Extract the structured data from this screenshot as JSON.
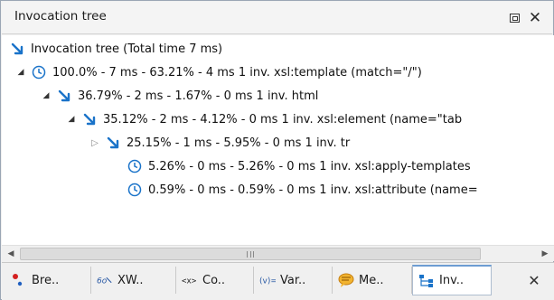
{
  "panel": {
    "title": "Invocation tree",
    "minimize_icon": "restore-icon",
    "close_icon": "close-icon"
  },
  "tree": {
    "rows": [
      {
        "text": "Invocation tree (Total time  7 ms)",
        "icon": "arrow-icon",
        "toggle": "none"
      },
      {
        "text": "100.0% - 7 ms - 63.21% - 4 ms 1 inv. xsl:template (match=\"/\")",
        "icon": "clock-icon",
        "toggle": "expanded"
      },
      {
        "text": "36.79% - 2 ms - 1.67% - 0 ms 1 inv. html",
        "icon": "arrow-icon",
        "toggle": "expanded"
      },
      {
        "text": "35.12% - 2 ms - 4.12% - 0 ms 1 inv. xsl:element (name=\"tab",
        "icon": "arrow-icon",
        "toggle": "expanded"
      },
      {
        "text": "25.15% - 1 ms - 5.95% - 0 ms 1 inv. tr",
        "icon": "arrow-icon",
        "toggle": "collapsed"
      },
      {
        "text": "5.26% - 0 ms - 5.26% - 0 ms 1 inv. xsl:apply-templates",
        "icon": "clock-icon",
        "toggle": "none"
      },
      {
        "text": "0.59% - 0 ms - 0.59% - 0 ms 1 inv. xsl:attribute (name=",
        "icon": "clock-icon",
        "toggle": "none"
      }
    ]
  },
  "scrollbar": {
    "grip_label": "III"
  },
  "tabs": [
    {
      "label": "Bre..",
      "icon": "breakpoints-icon",
      "active": false
    },
    {
      "label": "XW..",
      "icon": "xwatch-icon",
      "active": false
    },
    {
      "label": "Co..",
      "icon": "context-icon",
      "active": false
    },
    {
      "label": "Var..",
      "icon": "variables-icon",
      "active": false
    },
    {
      "label": "Me..",
      "icon": "messages-icon",
      "active": false
    },
    {
      "label": "Inv..",
      "icon": "invocation-tree-icon",
      "active": true
    }
  ],
  "colors": {
    "accent_blue": "#1a73c9",
    "tab_active_border": "#6d9dd3",
    "breakpoint_red": "#d42020"
  }
}
